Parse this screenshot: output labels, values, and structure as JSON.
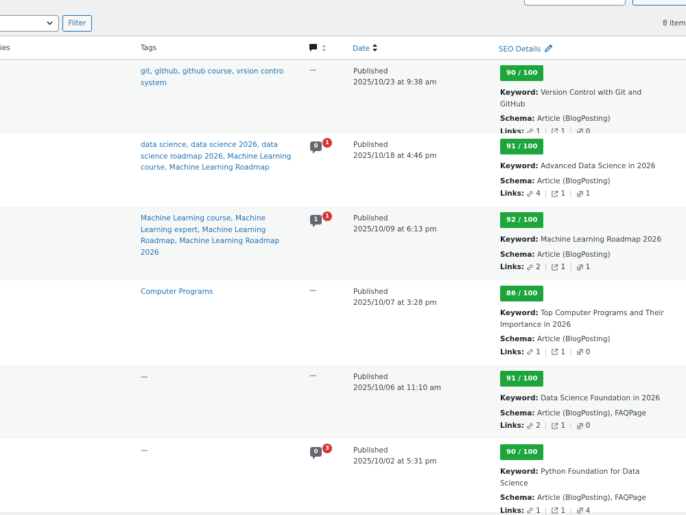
{
  "filter_bar": {
    "filter_label": "Filter",
    "items_count": "8 items"
  },
  "columns": {
    "categories": "ies",
    "tags": "Tags",
    "date": "Date",
    "seo": "SEO Details"
  },
  "labels": {
    "keyword": "Keyword:",
    "schema": "Schema:",
    "links": "Links:"
  },
  "rows": [
    {
      "tags": "git, github, github course, vrsion contro system",
      "comments": "—",
      "status": "Published",
      "date": "2025/10/23 at 9:38 am",
      "score": "90 / 100",
      "keyword": "Version Control with Git and GitHub",
      "schema": "Article (BlogPosting)",
      "internal_links": "1",
      "external_links": "1",
      "incoming_links": "0"
    },
    {
      "tags": "data science, data science 2026, data science roadmap 2026, Machine Learning course, Machine Learning Roadmap",
      "comments": "0",
      "pending": "1",
      "status": "Published",
      "date": "2025/10/18 at 4:46 pm",
      "score": "91 / 100",
      "keyword": "Advanced Data Science in 2026",
      "schema": "Article (BlogPosting)",
      "internal_links": "4",
      "external_links": "1",
      "incoming_links": "1"
    },
    {
      "tags": "Machine Learning course, Machine Learning expert, Machine Learning Roadmap, Machine Learning Roadmap 2026",
      "comments": "1",
      "pending": "1",
      "status": "Published",
      "date": "2025/10/09 at 6:13 pm",
      "score": "92 / 100",
      "keyword": "Machine Learning Roadmap 2026",
      "schema": "Article (BlogPosting)",
      "internal_links": "2",
      "external_links": "1",
      "incoming_links": "1"
    },
    {
      "tags": "Computer Programs",
      "comments": "—",
      "status": "Published",
      "date": "2025/10/07 at 3:28 pm",
      "score": "86 / 100",
      "keyword": "Top Computer Programs and Their Importance in 2026",
      "schema": "Article (BlogPosting)",
      "internal_links": "1",
      "external_links": "1",
      "incoming_links": "0"
    },
    {
      "tags": "—",
      "comments": "—",
      "status": "Published",
      "date": "2025/10/06 at 11:10 am",
      "score": "91 / 100",
      "keyword": "Data Science Foundation in 2026",
      "schema": "Article (BlogPosting), FAQPage",
      "internal_links": "2",
      "external_links": "1",
      "incoming_links": "0"
    },
    {
      "tags": "—",
      "comments": "0",
      "pending": "3",
      "status": "Published",
      "date": "2025/10/02 at 5:31 pm",
      "score": "90 / 100",
      "keyword": "Python Foundation for Data Science",
      "schema": "Article (BlogPosting), FAQPage",
      "internal_links": "1",
      "external_links": "1",
      "incoming_links": "4"
    }
  ],
  "colors": {
    "link": "#2271b1",
    "score_green": "#1da53b",
    "badge_red": "#d63638",
    "bubble_gray": "#646970"
  }
}
